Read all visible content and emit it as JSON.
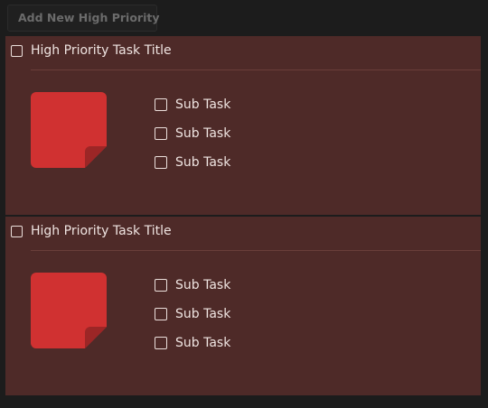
{
  "toolbar": {
    "add_label": "Add New High Priority"
  },
  "colors": {
    "background": "#1c1c1c",
    "card": "#4e2a28",
    "note": "#d03131",
    "text": "#efe4e1"
  },
  "tasks": [
    {
      "title": "High Priority Task Title",
      "checked": false,
      "icon": "sticky-note-icon",
      "subtasks": [
        {
          "label": "Sub Task",
          "checked": false
        },
        {
          "label": "Sub Task",
          "checked": false
        },
        {
          "label": "Sub Task",
          "checked": false
        }
      ]
    },
    {
      "title": "High Priority Task Title",
      "checked": false,
      "icon": "sticky-note-icon",
      "subtasks": [
        {
          "label": "Sub Task",
          "checked": false
        },
        {
          "label": "Sub Task",
          "checked": false
        },
        {
          "label": "Sub Task",
          "checked": false
        }
      ]
    }
  ]
}
